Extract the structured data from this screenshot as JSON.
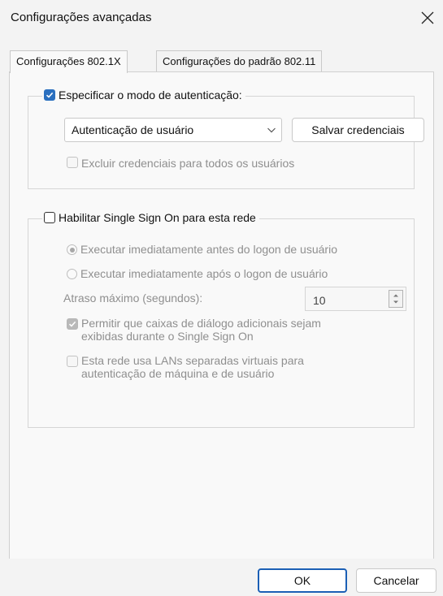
{
  "window": {
    "title": "Configurações avançadas",
    "close_icon": "close-icon"
  },
  "tabs": [
    {
      "label": "Configurações 802.1X",
      "active": true
    },
    {
      "label": "Configurações do padrão 802.11",
      "active": false
    }
  ],
  "auth_group": {
    "legend_label": "Especificar o modo de autenticação:",
    "checked": true,
    "mode_select_value": "Autenticação de usuário",
    "save_credentials_label": "Salvar credenciais",
    "delete_credentials_label": "Excluir credenciais para todos os usuários",
    "delete_credentials_checked": false
  },
  "sso_group": {
    "legend_label": "Habilitar Single Sign On para esta rede",
    "checked": false,
    "radio_before_label": "Executar imediatamente antes do logon de usuário",
    "radio_before_selected": true,
    "radio_after_label": "Executar imediatamente após o logon de usuário",
    "radio_after_selected": false,
    "max_delay_label": "Atraso máximo (segundos):",
    "max_delay_value": "10",
    "allow_dialogs_label_line1": "Permitir que caixas de diálogo adicionais sejam",
    "allow_dialogs_label_line2": "exibidas durante o Single Sign On",
    "allow_dialogs_checked": true,
    "vlan_label_line1": "Esta rede usa LANs separadas virtuais para",
    "vlan_label_line2": "autenticação de máquina e de usuário",
    "vlan_checked": false
  },
  "footer": {
    "ok_label": "OK",
    "cancel_label": "Cancelar"
  },
  "colors": {
    "accent": "#2a6fbf",
    "primary_button_border": "#1b5fb5"
  }
}
